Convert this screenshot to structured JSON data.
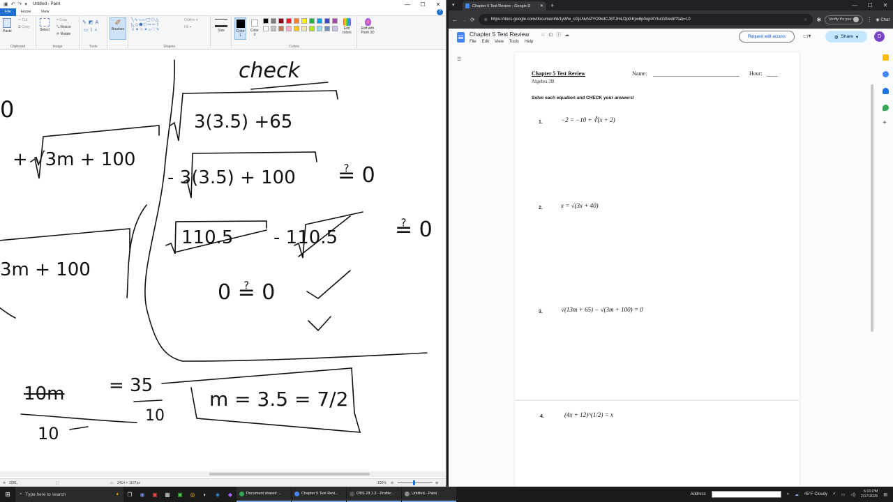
{
  "paint": {
    "title": "Untitled - Paint",
    "tabs": [
      "File",
      "Home",
      "View"
    ],
    "groups": {
      "clipboard": "Clipboard",
      "image": "Image",
      "tools": "Tools",
      "shapes": "Shapes",
      "colors": "Colors"
    },
    "buttons": {
      "paste": "Paste",
      "cut": "Cut",
      "copy": "Copy",
      "select": "Select",
      "crop": "Crop",
      "resize": "Resize",
      "rotate": "Rotate",
      "brushes": "Brushes",
      "outline": "Outline",
      "fill": "Fill",
      "size": "Size",
      "color1": "Color 1",
      "color2": "Color 2",
      "edit_colors": "Edit colors",
      "edit_paint3d": "Edit with Paint 3D"
    },
    "palette": [
      "#000000",
      "#7f7f7f",
      "#880015",
      "#ed1c24",
      "#ff7f27",
      "#fff200",
      "#22b14c",
      "#00a2e8",
      "#3f48cc",
      "#a349a4",
      "#ffffff",
      "#c3c3c3",
      "#b97a57",
      "#ffaec9",
      "#ffc90e",
      "#efe4b0",
      "#b5e61d",
      "#99d9ea",
      "#7092be",
      "#c8bfe7"
    ],
    "status": {
      "cursor": "2081,",
      "size": "3414 × 1167px",
      "zoom": "100%"
    },
    "canvas_text": {
      "check": "check",
      "line1": "3(3.5) +65",
      "line2": "- 3(3.5) + 100",
      "qeq1": "≟ 0",
      "line3a": "110.5",
      "line3b": "- 110.5",
      "qeq2": "≟ 0",
      "zero_check": "0 ≟ 0",
      "left1": "+ √3m + 100",
      "left2": "3m + 100",
      "left0": "0",
      "frac_num": "10m",
      "frac_eq": "= 35",
      "frac_den": "10",
      "frac_den2": "10",
      "answer": "m = 3.5 = 7/2"
    }
  },
  "chrome": {
    "tab_title": "Chapter 5 Test Review - Google D",
    "url": "https://docs.google.com/document/d/1yWw_cGjLNvNZYO9xdCJ8TJmLDpGKpx6p0opiXYtuIG0/edit?tab=t.0",
    "verify_label": "Verify it's you",
    "chat_label": "Chat"
  },
  "docs": {
    "doc_title": "Chapter 5 Test Review",
    "menu": [
      "File",
      "Edit",
      "View",
      "Tools",
      "Help"
    ],
    "request_edit": "Request edit access",
    "share": "Share",
    "avatar_letter": "D",
    "worksheet": {
      "title": "Chapter 5 Test Review",
      "subtitle": "Algebra 2B",
      "name_label": "Name:",
      "hour_label": "Hour:",
      "instructions": "Solve each equation and CHECK your answers!",
      "questions": [
        {
          "num": "1.",
          "eq": "−2 = −10 + ∛(x + 2)"
        },
        {
          "num": "2.",
          "eq": "x = √(3x + 40)"
        },
        {
          "num": "3.",
          "eq": "√(13m + 65) − √(3m + 100) = 0"
        },
        {
          "num": "4.",
          "eq": "(4x + 12)^(1/2) = x"
        }
      ]
    }
  },
  "taskbar": {
    "search_placeholder": "Type here to search",
    "apps": [
      {
        "label": "Document shared ...",
        "color": "#34a853"
      },
      {
        "label": "Chapter 5 Test Revi...",
        "color": "#4285f4"
      },
      {
        "label": "OBS 28.1.3 - Profile:...",
        "color": "#555555"
      },
      {
        "label": "Untitled - Paint",
        "color": "#8a8a8a"
      }
    ],
    "address_label": "Address",
    "weather": "45°F Cloudy",
    "time": "6:10 PM",
    "date": "2/17/2025"
  }
}
